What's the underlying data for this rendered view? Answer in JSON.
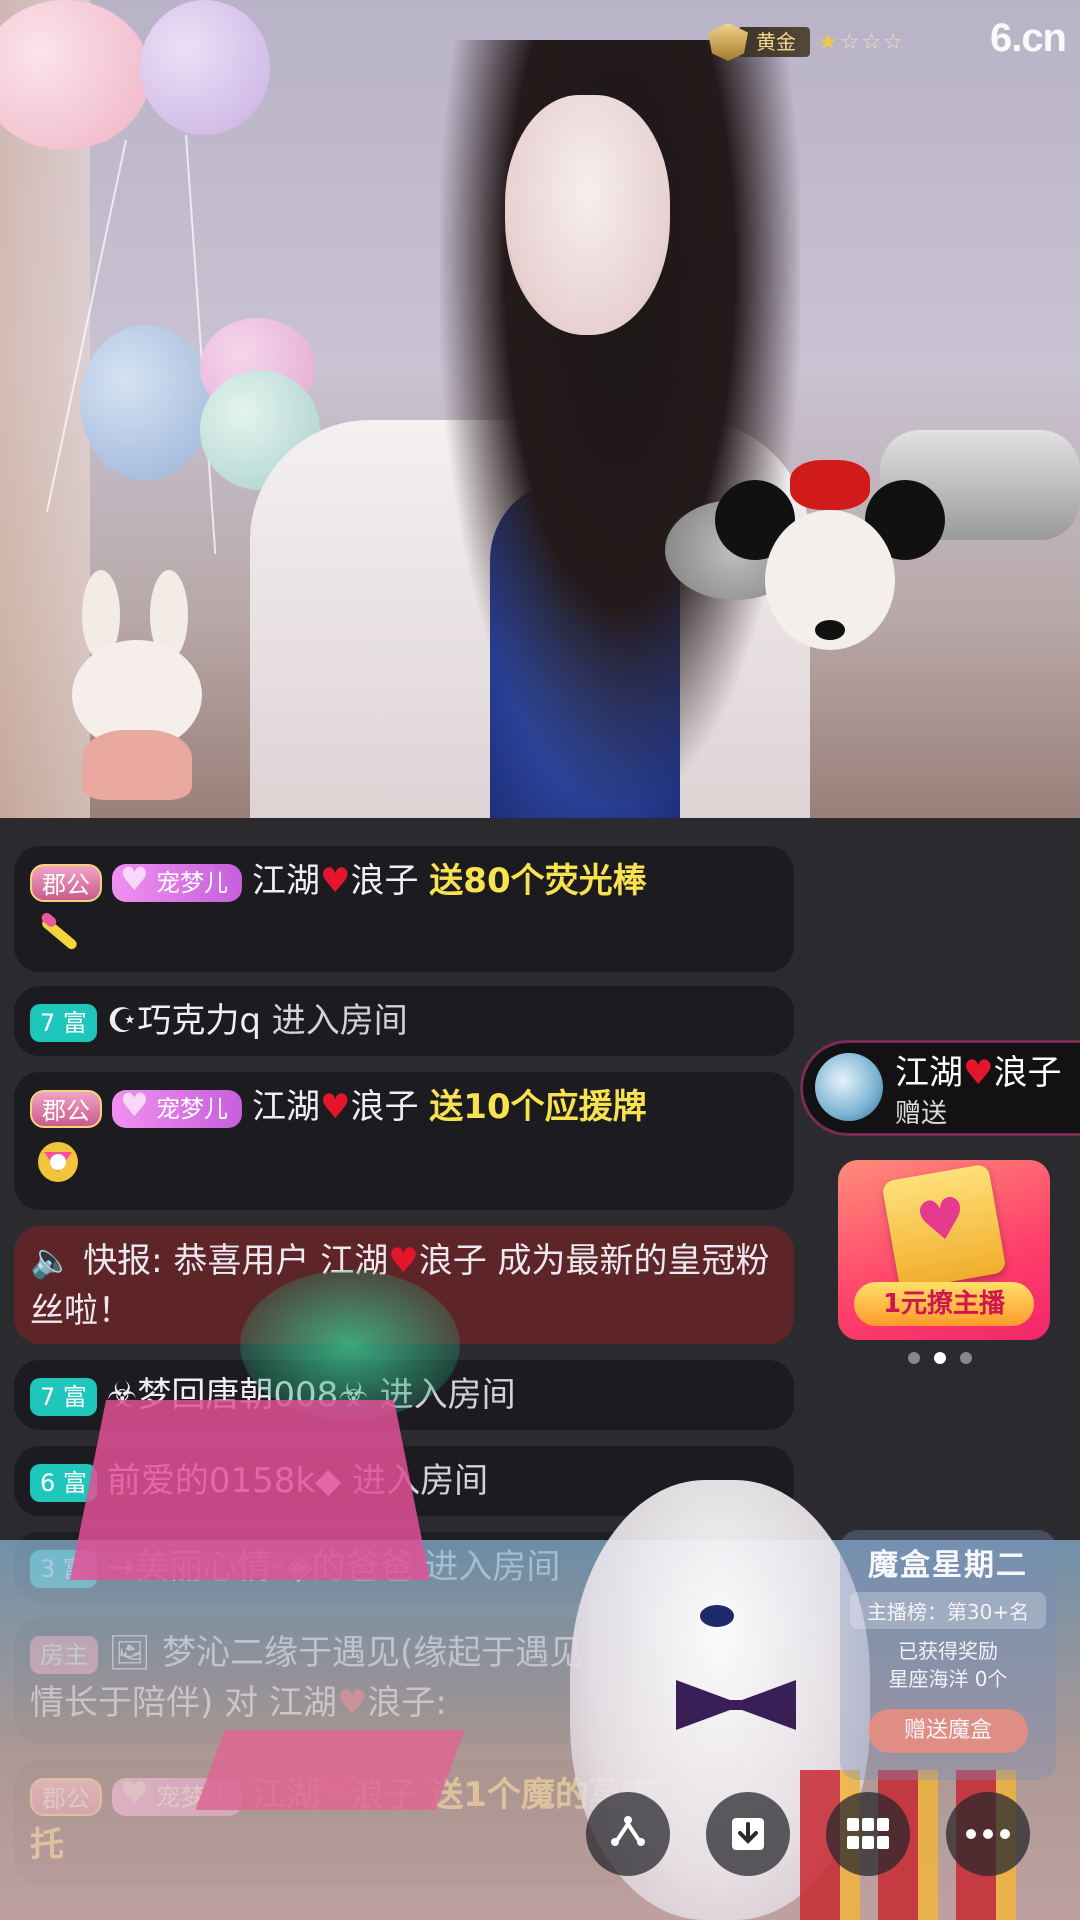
{
  "stream": {
    "rank_label": "黄金",
    "stars_on": "★",
    "stars_off": "☆☆☆",
    "site_logo": "6.cn"
  },
  "chat": {
    "messages": [
      {
        "type": "gift",
        "tag1": "郡公",
        "tag2": "宠梦儿",
        "user": "江湖",
        "user2": "浪子",
        "action": "送80个荧光棒"
      },
      {
        "type": "join",
        "level": "7 富",
        "user": "☪巧克力q",
        "action": "进入房间"
      },
      {
        "type": "gift",
        "tag1": "郡公",
        "tag2": "宠梦儿",
        "user": "江湖",
        "user2": "浪子",
        "action": "送10个应援牌"
      },
      {
        "type": "alert",
        "prefix": "快报: 恭喜用户 江湖",
        "suffix": "浪子 成为最新的皇冠粉丝啦！"
      },
      {
        "type": "join",
        "level": "7 富",
        "user": "☣梦回唐朝008☣",
        "action": "进入房间"
      },
      {
        "type": "join",
        "level": "6 富",
        "user": "前爱的0158k◆",
        "action": "进入房间"
      },
      {
        "type": "join",
        "level": "3 富",
        "user": "→美丽心情ᵕ◈的爸爸",
        "action": "进入房间"
      },
      {
        "type": "chat",
        "tag1": "房主",
        "user": "梦沁二缘于遇见(缘起于遇见",
        "line2": "情长于陪伴) 对 江湖",
        "user2": "浪子:"
      },
      {
        "type": "gift",
        "tag1": "郡公",
        "tag2": "宠梦儿",
        "user": "江湖",
        "user2": "浪子",
        "action": "送1个魔的莫吉",
        "line2": "托"
      }
    ]
  },
  "sender_card": {
    "name": "江湖",
    "name2": "浪子",
    "sub": "赠送"
  },
  "promo": {
    "button": "1元撩主播"
  },
  "board": {
    "title": "魔盒星期二",
    "rank": "主播榜：第30+名",
    "line1": "已获得奖励",
    "line2": "星座海洋  0个",
    "give": "赠送魔盒"
  },
  "toolbar": {
    "share_icon": "share-icon",
    "download_icon": "download-icon",
    "grid_icon": "grid-icon",
    "more_icon": "more-icon"
  }
}
